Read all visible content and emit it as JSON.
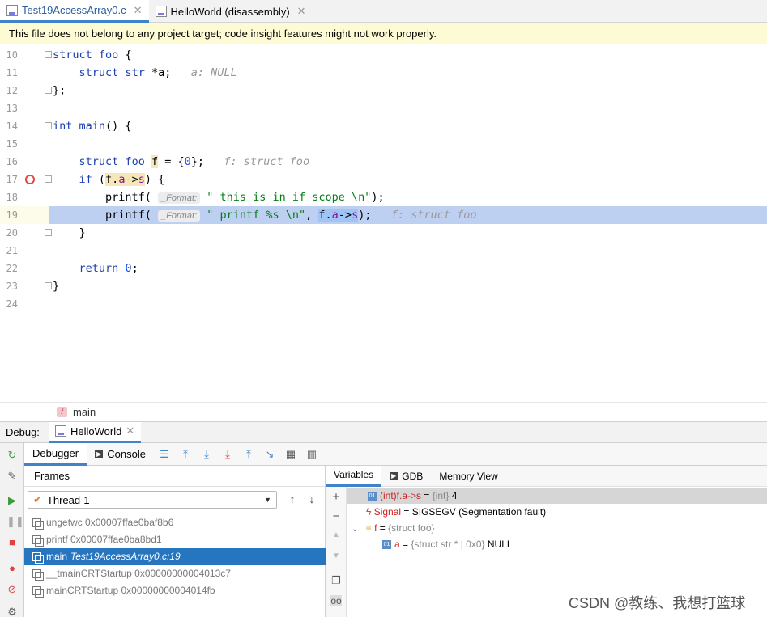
{
  "tabs": [
    {
      "label": "Test19AccessArray0.c",
      "active": true
    },
    {
      "label": "HelloWorld (disassembly)",
      "active": false
    }
  ],
  "banner": {
    "text": "This file does not belong to any project target; code insight features might not work properly."
  },
  "editor": {
    "lines": [
      {
        "n": "10"
      },
      {
        "n": "11"
      },
      {
        "n": "12"
      },
      {
        "n": "13"
      },
      {
        "n": "14"
      },
      {
        "n": "15"
      },
      {
        "n": "16"
      },
      {
        "n": "17"
      },
      {
        "n": "18"
      },
      {
        "n": "19"
      },
      {
        "n": "20"
      },
      {
        "n": "21"
      },
      {
        "n": "22"
      },
      {
        "n": "23"
      },
      {
        "n": "24"
      }
    ],
    "inlay_format": "_Format:",
    "hint_a": "a: NULL",
    "hint_f": "f: struct foo",
    "hint_f2": "f: struct foo"
  },
  "breadcrumb": {
    "function": "main",
    "badge": "f"
  },
  "debug": {
    "label": "Debug:",
    "session": "HelloWorld"
  },
  "debugger_toolbar": {
    "debugger_tab": "Debugger",
    "console_tab": "Console"
  },
  "frames": {
    "header": "Frames",
    "thread": "Thread-1",
    "items": [
      {
        "name": "ungetwc 0x00007ffae0baf8b6",
        "file": ""
      },
      {
        "name": "printf 0x00007ffae0ba8bd1",
        "file": ""
      },
      {
        "name": "main ",
        "file": "Test19AccessArray0.c:19"
      },
      {
        "name": "__tmainCRTStartup 0x00000000004013c7",
        "file": ""
      },
      {
        "name": "mainCRTStartup 0x00000000004014fb",
        "file": ""
      }
    ]
  },
  "variables": {
    "tabs": [
      "Variables",
      "GDB",
      "Memory View"
    ],
    "rows": {
      "r0_name": "(int)f.a->s",
      "r0_eq": " = ",
      "r0_type": "{int}",
      "r0_val": " 4",
      "r1_name": "Signal",
      "r1_val": " = SIGSEGV (Segmentation fault)",
      "r2_name": "f",
      "r2_eq": " = ",
      "r2_type": "{struct foo}",
      "r3_name": "a",
      "r3_eq": " = ",
      "r3_type": "{struct str * | 0x0}",
      "r3_val": " NULL"
    },
    "badge": "01"
  },
  "watermark": "CSDN @教练、我想打篮球"
}
